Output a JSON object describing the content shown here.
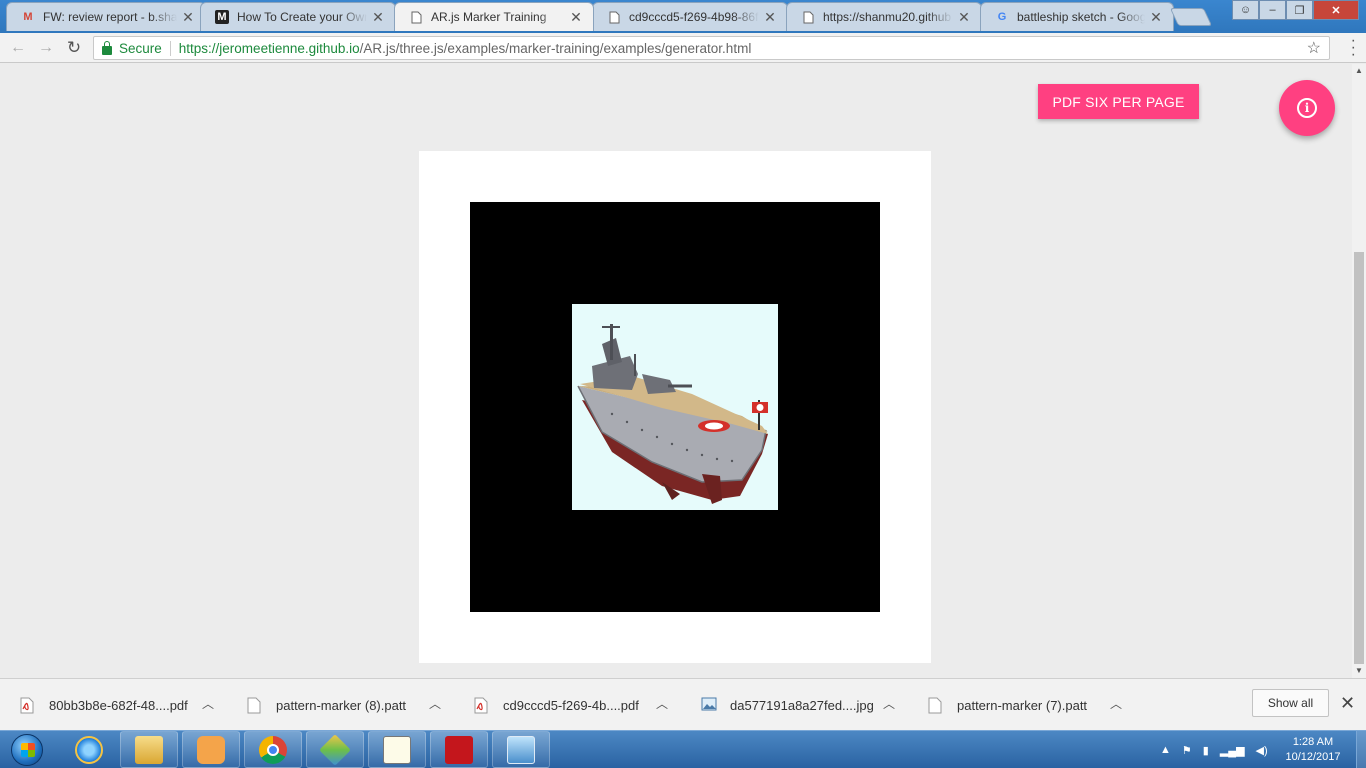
{
  "browser": {
    "tabs": [
      {
        "title": "FW: review report - b.sha",
        "favicon": "gmail-icon"
      },
      {
        "title": "How To Create your Own",
        "favicon": "medium-icon"
      },
      {
        "title": "AR.js Marker Training",
        "favicon": "page-icon"
      },
      {
        "title": "cd9cccd5-f269-4b98-86f",
        "favicon": "page-icon"
      },
      {
        "title": "https://shanmu20.github",
        "favicon": "page-icon"
      },
      {
        "title": "battleship sketch - Googl",
        "favicon": "google-icon"
      }
    ],
    "active_tab_index": 2,
    "secure_label": "Secure",
    "url_host": "https://jeromeetienne.github.io",
    "url_path": "/AR.js/three.js/examples/marker-training/examples/generator.html"
  },
  "page": {
    "pdf_button_label": "PDF SIX PER PAGE",
    "info_icon": "i",
    "marker_image": "battleship-image",
    "colors": {
      "accent": "#ff4081",
      "marker_border": "#000000",
      "marker_background": "#ffffff",
      "image_background": "#e6fbfb"
    }
  },
  "downloads": {
    "items": [
      {
        "name": "80bb3b8e-682f-48....pdf",
        "type": "pdf"
      },
      {
        "name": "pattern-marker (8).patt",
        "type": "file"
      },
      {
        "name": "cd9cccd5-f269-4b....pdf",
        "type": "pdf"
      },
      {
        "name": "da577191a8a27fed....jpg",
        "type": "image"
      },
      {
        "name": "pattern-marker (7).patt",
        "type": "file"
      }
    ],
    "show_all_label": "Show all"
  },
  "taskbar": {
    "apps": [
      "internet-explorer-icon",
      "file-explorer-icon",
      "media-player-icon",
      "chrome-icon",
      "paint-icon",
      "graph-icon",
      "acrobat-icon",
      "photo-viewer-icon"
    ],
    "time": "1:28 AM",
    "date": "10/12/2017"
  }
}
